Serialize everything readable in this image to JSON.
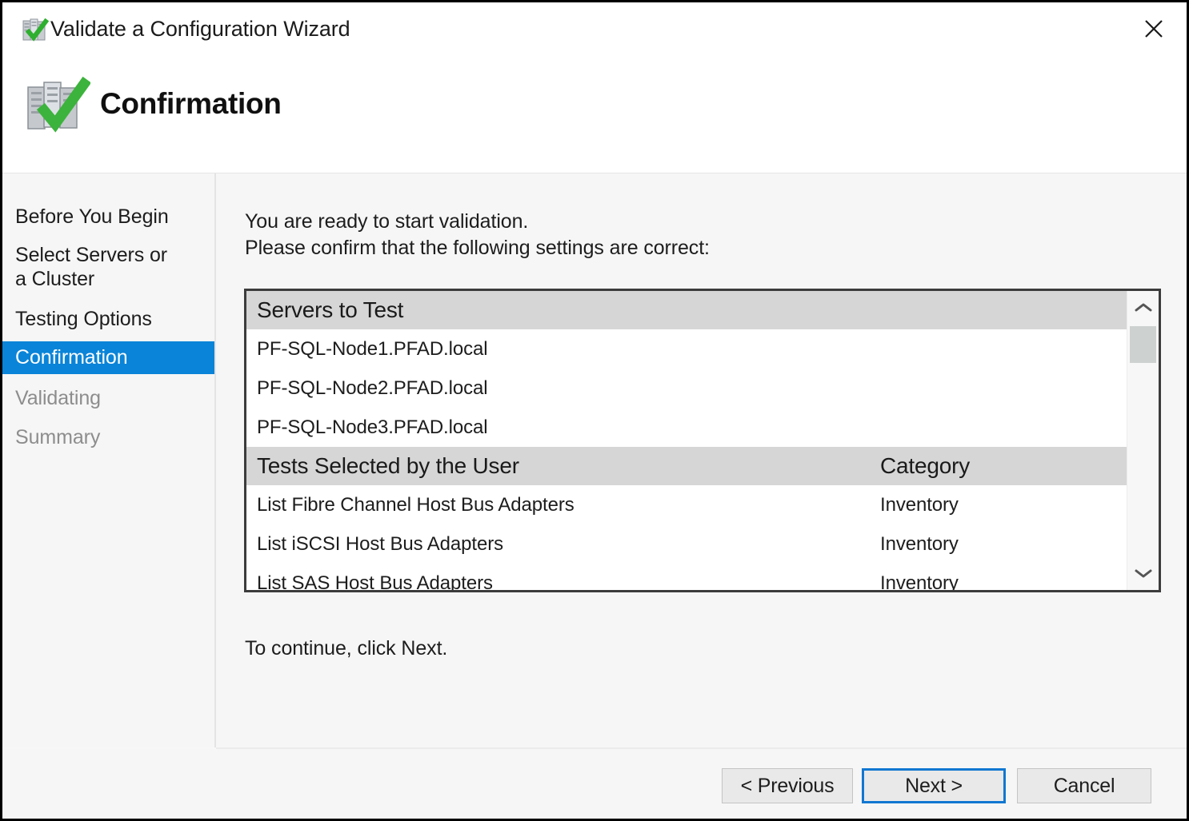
{
  "window": {
    "title": "Validate a Configuration Wizard",
    "title_icon": "servers-check-icon",
    "close_icon": "close-icon"
  },
  "header": {
    "title": "Confirmation",
    "icon": "servers-check-large-icon"
  },
  "sidebar": {
    "items": [
      {
        "label": "Before You Begin",
        "state": "normal"
      },
      {
        "label": "Select Servers or a Cluster",
        "state": "normal"
      },
      {
        "label": "Testing Options",
        "state": "normal"
      },
      {
        "label": "Confirmation",
        "state": "active"
      },
      {
        "label": "Validating",
        "state": "disabled"
      },
      {
        "label": "Summary",
        "state": "disabled"
      }
    ],
    "active_bg": "#0a84d8",
    "disabled_color": "#8d8d8d"
  },
  "main": {
    "intro_line1": "You are ready to start validation.",
    "intro_line2": "Please confirm that the following settings are correct:",
    "continue_text": "To continue, click Next.",
    "list": {
      "groups": [
        {
          "header_col1": "Servers to Test",
          "header_col2": "",
          "rows": [
            {
              "col1": "PF-SQL-Node1.PFAD.local",
              "col2": ""
            },
            {
              "col1": "PF-SQL-Node2.PFAD.local",
              "col2": ""
            },
            {
              "col1": "PF-SQL-Node3.PFAD.local",
              "col2": ""
            }
          ]
        },
        {
          "header_col1": "Tests Selected by the User",
          "header_col2": "Category",
          "rows": [
            {
              "col1": "List Fibre Channel Host Bus Adapters",
              "col2": "Inventory"
            },
            {
              "col1": "List iSCSI Host Bus Adapters",
              "col2": "Inventory"
            },
            {
              "col1": "List SAS Host Bus Adapters",
              "col2": "Inventory"
            }
          ]
        }
      ],
      "scrollbar": {
        "up_icon": "chevron-up-icon",
        "down_icon": "chevron-down-icon",
        "thumb_position": "top"
      }
    }
  },
  "footer": {
    "previous_label": "< Previous",
    "next_label": "Next >",
    "cancel_label": "Cancel",
    "focused_button": "Next >",
    "focus_color": "#1177d1"
  }
}
